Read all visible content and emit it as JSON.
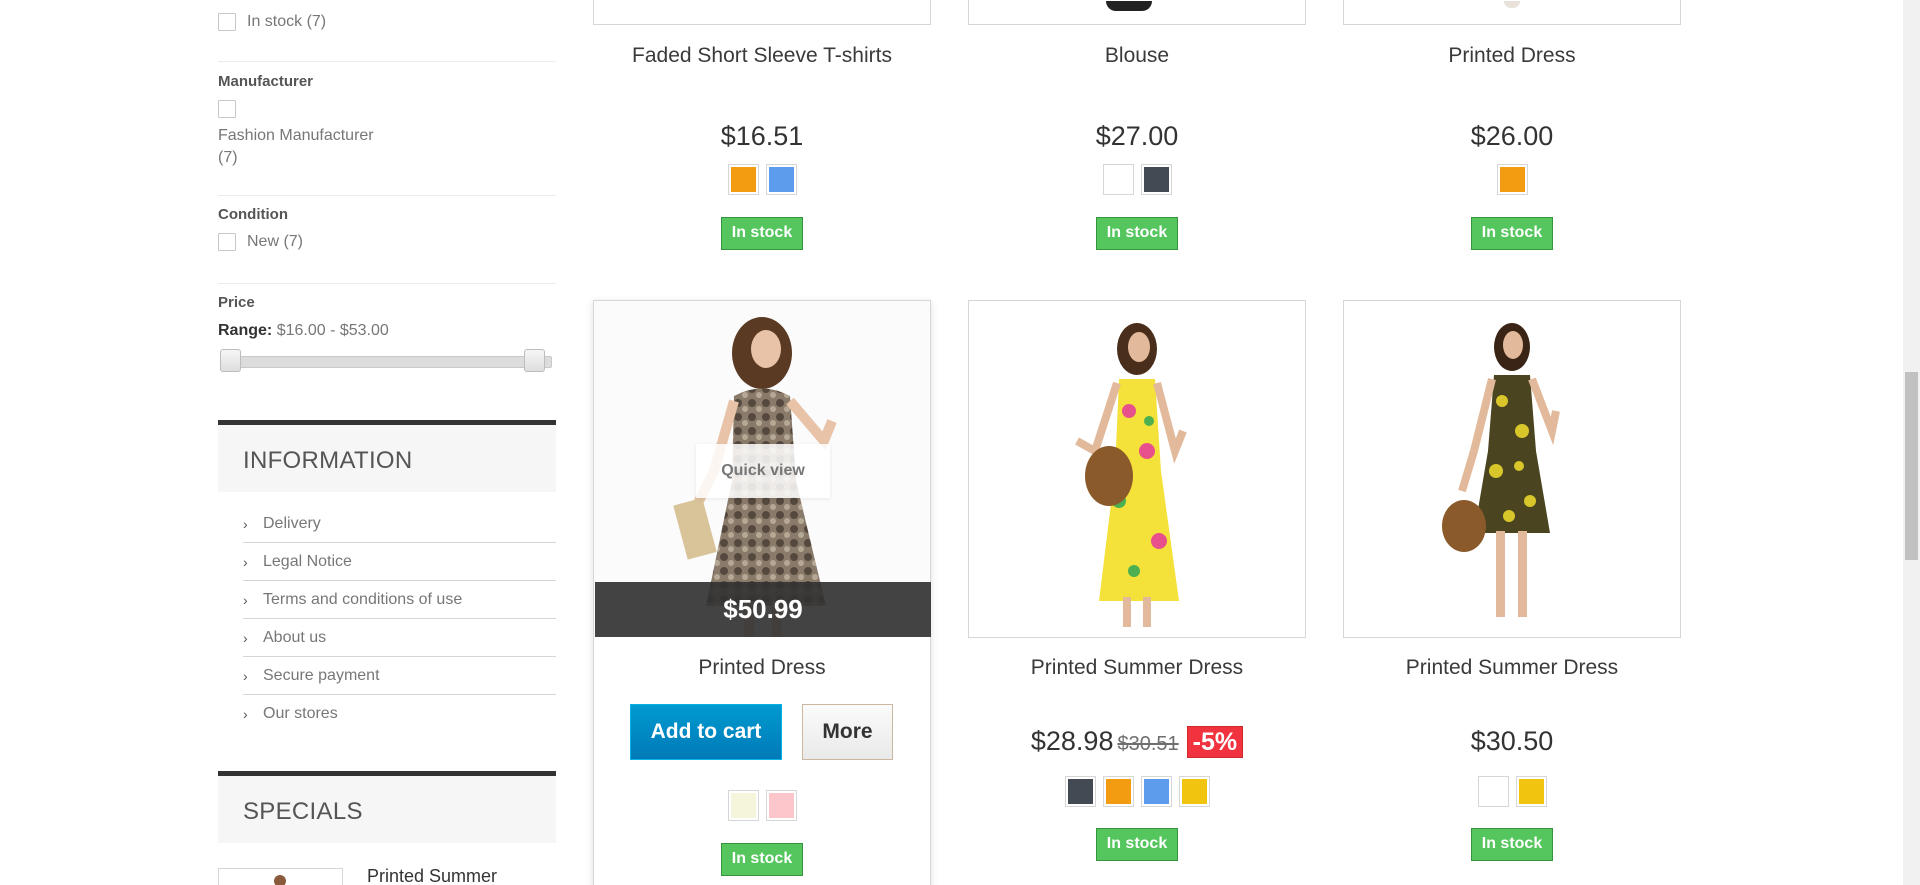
{
  "filters": {
    "availability": {
      "in_stock_label": "In stock (7)"
    },
    "manufacturer": {
      "title": "Manufacturer",
      "option_line1": "Fashion Manufacturer",
      "option_line2": "(7)"
    },
    "condition": {
      "title": "Condition",
      "new_label": "New (7)"
    },
    "price": {
      "title": "Price",
      "range_label": "Range:",
      "range_value": "$16.00 - $53.00"
    }
  },
  "information": {
    "title": "INFORMATION",
    "items": [
      "Delivery",
      "Legal Notice",
      "Terms and conditions of use",
      "About us",
      "Secure payment",
      "Our stores"
    ]
  },
  "specials": {
    "title": "SPECIALS",
    "first_item": "Printed Summer"
  },
  "products_row1": [
    {
      "name": "Faded Short Sleeve T-shirts",
      "price": "$16.51",
      "colors": [
        "#f39c11",
        "#5d9cec"
      ],
      "stock": "In stock"
    },
    {
      "name": "Blouse",
      "price": "$27.00",
      "colors": [
        "#ffffff",
        "#434a54"
      ],
      "stock": "In stock"
    },
    {
      "name": "Printed Dress",
      "price": "$26.00",
      "colors": [
        "#f39c11"
      ],
      "stock": "In stock"
    }
  ],
  "products_row2": [
    {
      "name": "Printed Dress",
      "price": "$50.99",
      "quick_view": "Quick view",
      "add_to_cart": "Add to cart",
      "more": "More",
      "colors": [
        "#f5f5dc",
        "#fcc6cb"
      ],
      "stock": "In stock"
    },
    {
      "name": "Printed Summer Dress",
      "price": "$28.98",
      "old_price": "$30.51",
      "discount": "-5%",
      "colors": [
        "#434a54",
        "#f39c11",
        "#5d9cec",
        "#f1c40f"
      ],
      "stock": "In stock"
    },
    {
      "name": "Printed Summer Dress",
      "price": "$30.50",
      "colors": [
        "#ffffff",
        "#f1c40f"
      ],
      "stock": "In stock"
    }
  ]
}
